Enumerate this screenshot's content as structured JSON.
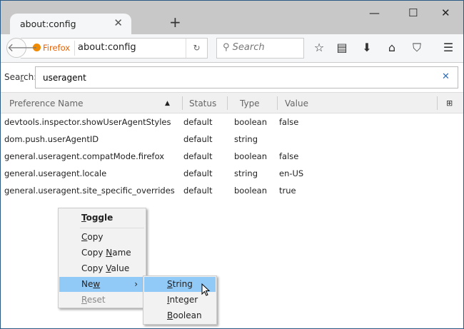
{
  "window": {
    "controls": [
      "minimize",
      "maximize",
      "close"
    ]
  },
  "tab": {
    "title": "about:config"
  },
  "navbar": {
    "identity": "Firefox",
    "url": "about:config",
    "search_placeholder": "Search",
    "icons": [
      "star-icon",
      "reading-list-icon",
      "download-icon",
      "home-icon",
      "pocket-icon",
      "menu-icon"
    ]
  },
  "search": {
    "label": "Search:",
    "label_key": "r",
    "value": "useragent"
  },
  "table": {
    "columns": [
      "Preference Name",
      "Status",
      "Type",
      "Value"
    ],
    "rows": [
      {
        "name": "devtools.inspector.showUserAgentStyles",
        "status": "default",
        "type": "boolean",
        "value": "false"
      },
      {
        "name": "dom.push.userAgentID",
        "status": "default",
        "type": "string",
        "value": ""
      },
      {
        "name": "general.useragent.compatMode.firefox",
        "status": "default",
        "type": "boolean",
        "value": "false"
      },
      {
        "name": "general.useragent.locale",
        "status": "default",
        "type": "string",
        "value": "en-US"
      },
      {
        "name": "general.useragent.site_specific_overrides",
        "status": "default",
        "type": "boolean",
        "value": "true"
      }
    ]
  },
  "context_menu": {
    "items": [
      {
        "label": "Toggle",
        "key": "T"
      },
      {
        "label": "Copy",
        "key": "C"
      },
      {
        "label": "Copy Name",
        "key": "N"
      },
      {
        "label": "Copy Value",
        "key": "V"
      },
      {
        "label": "New",
        "key": "w"
      },
      {
        "label": "Reset",
        "key": "R"
      }
    ]
  },
  "submenu": {
    "items": [
      {
        "label": "String",
        "key": "S"
      },
      {
        "label": "Integer",
        "key": "I"
      },
      {
        "label": "Boolean",
        "key": "B"
      }
    ]
  },
  "colors": {
    "highlight": "#91c9f7",
    "firefox_orange": "#e66000",
    "clear_blue": "#2a6ebf"
  }
}
